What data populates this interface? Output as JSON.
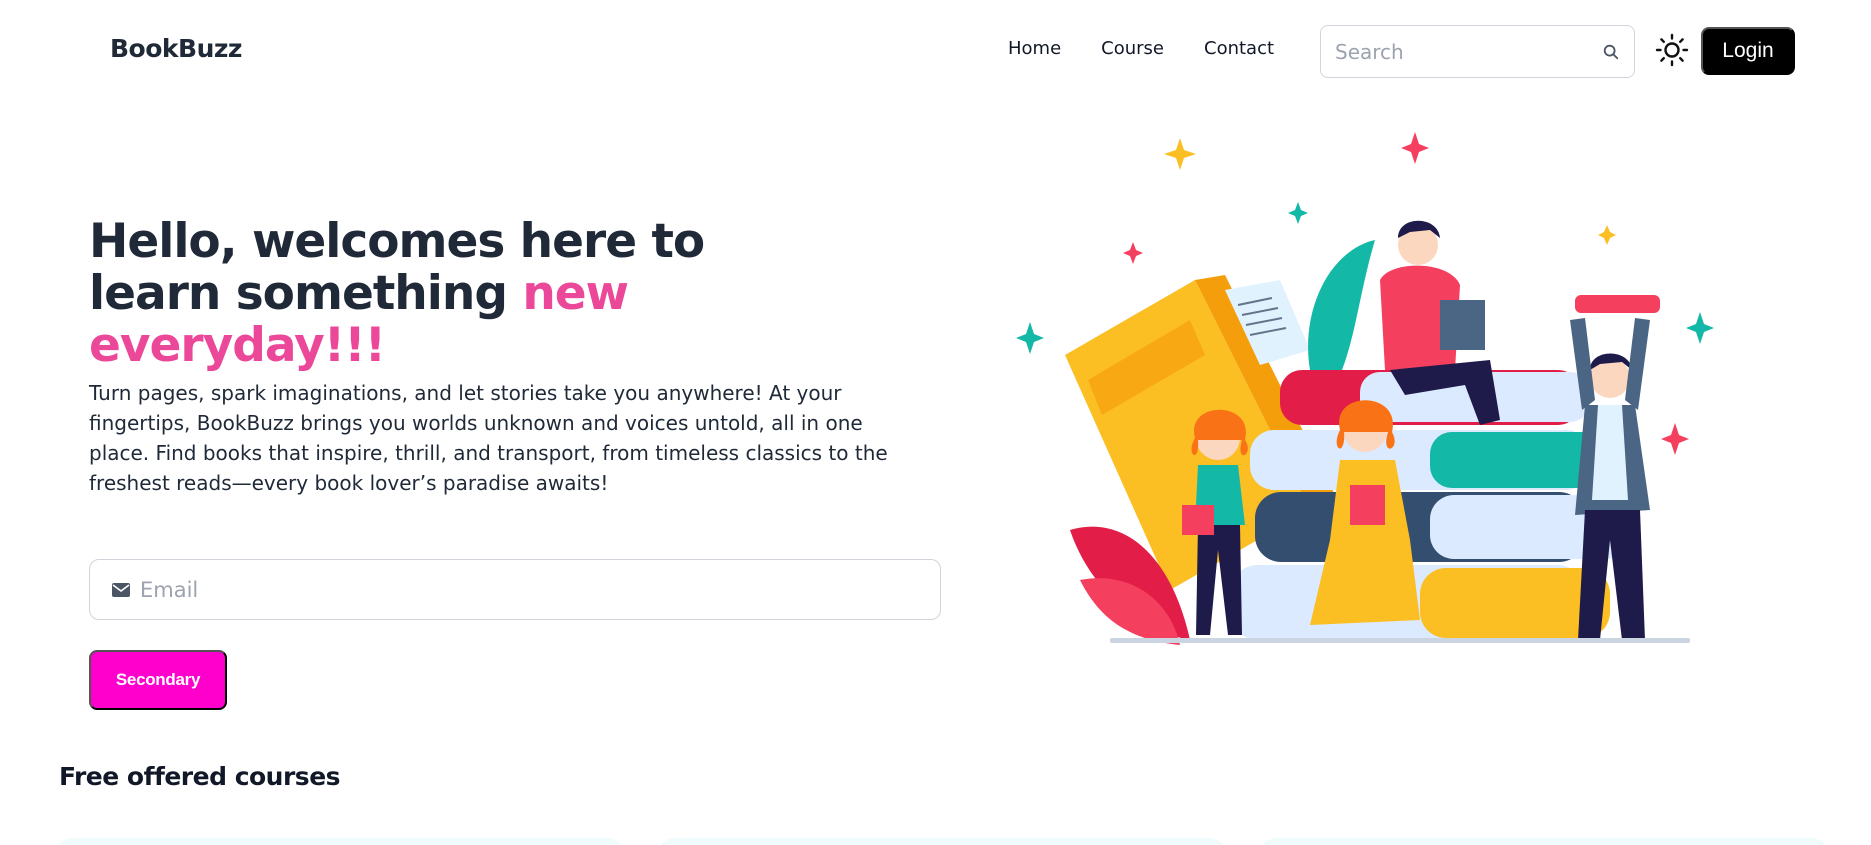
{
  "brand": {
    "name": "BookBuzz"
  },
  "nav": {
    "links": [
      {
        "label": "Home"
      },
      {
        "label": "Course"
      },
      {
        "label": "Contact"
      }
    ]
  },
  "search": {
    "placeholder": "Search",
    "value": ""
  },
  "login": {
    "label": "Login"
  },
  "hero": {
    "title_main": "Hello, welcomes here to learn something ",
    "title_highlight": "new everyday!!!",
    "description": "Turn pages, spark imaginations, and let stories take you anywhere! At your fingertips, BookBuzz brings you worlds unknown and voices untold, all in one place. Find books that inspire, thrill, and transport, from timeless classics to the freshest reads—every book lover’s paradise awaits!",
    "email_placeholder": "Email",
    "email_value": "",
    "secondary_label": "Secondary"
  },
  "courses": {
    "title": "Free offered courses"
  },
  "colors": {
    "accent": "#ec4899",
    "secondary_button": "#ff00cc",
    "login_button": "#000000",
    "text": "#1f2937"
  },
  "icons": {
    "search": "search-icon",
    "theme": "sun-icon",
    "email": "envelope-icon"
  }
}
